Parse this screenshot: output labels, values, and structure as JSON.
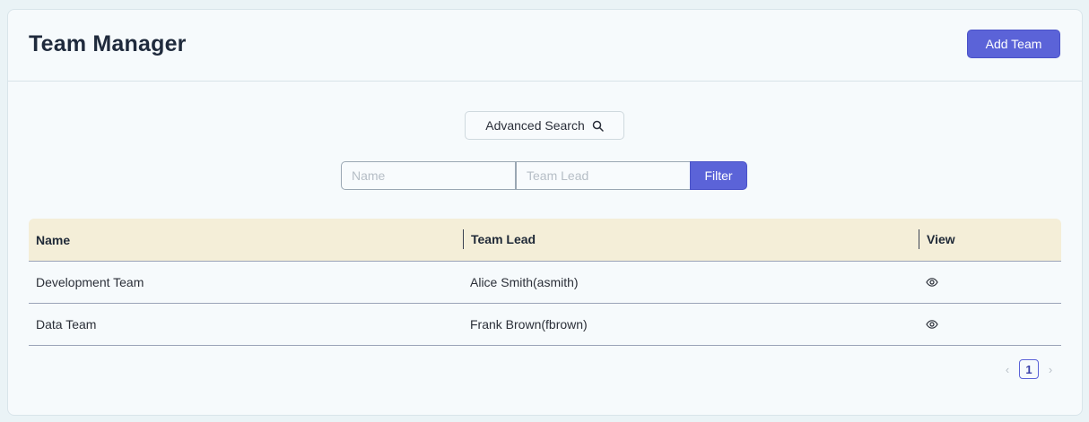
{
  "header": {
    "title": "Team Manager",
    "add_button": "Add Team"
  },
  "search": {
    "advanced_label": "Advanced Search",
    "name_placeholder": "Name",
    "lead_placeholder": "Team Lead",
    "filter_label": "Filter"
  },
  "table": {
    "columns": [
      "Name",
      "Team Lead",
      "View"
    ],
    "rows": [
      {
        "name": "Development Team",
        "lead": "Alice Smith(asmith)",
        "view_icon": "eye-icon"
      },
      {
        "name": "Data Team",
        "lead": "Frank Brown(fbrown)",
        "view_icon": "eye-icon"
      }
    ]
  },
  "pagination": {
    "prev": "‹",
    "current": "1",
    "next": "›"
  },
  "colors": {
    "accent": "#5b63d8",
    "table_header_bg": "#f4eed8",
    "page_bg": "#eaf3f6"
  }
}
